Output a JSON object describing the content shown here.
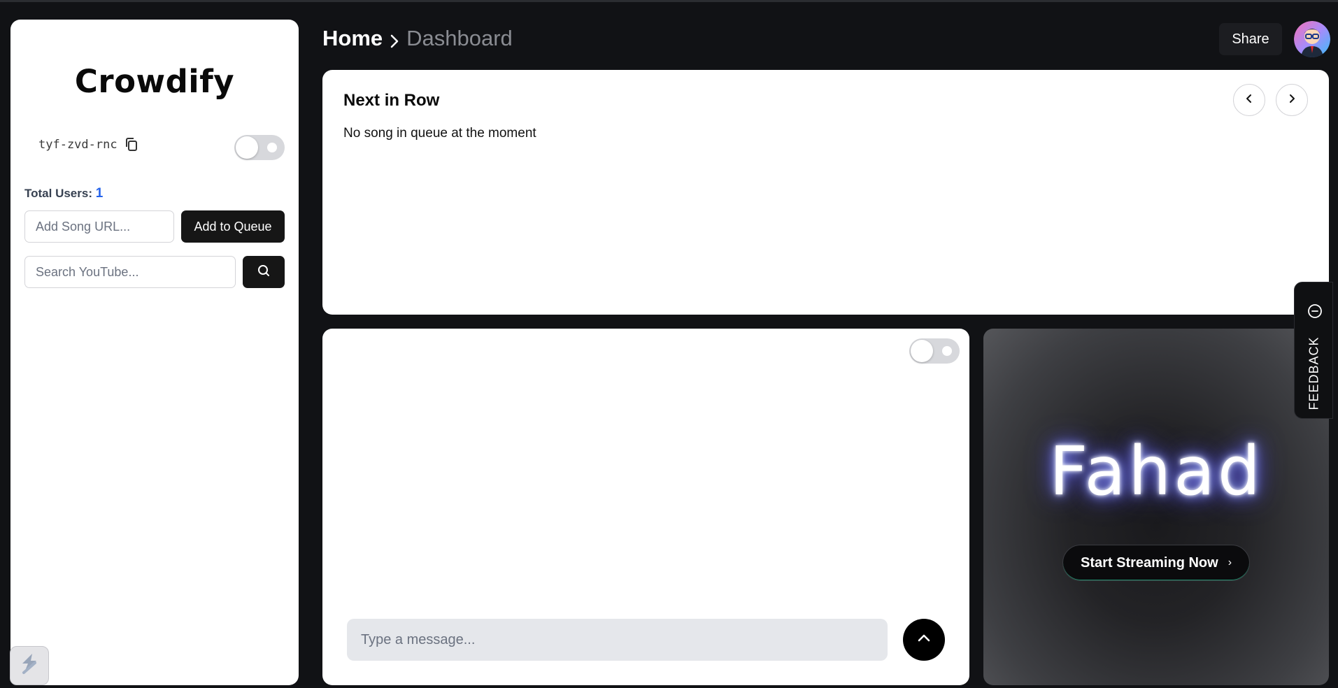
{
  "sidebar": {
    "brand": "Crowdify",
    "room_code": "tyf-zvd-rnc",
    "users_label": "Total Users:",
    "users_count": "1",
    "song_url_placeholder": "Add Song URL...",
    "add_button_label": "Add to Queue",
    "search_placeholder": "Search YouTube..."
  },
  "header": {
    "breadcrumb_home": "Home",
    "breadcrumb_current": "Dashboard",
    "share_label": "Share"
  },
  "queue": {
    "title": "Next in Row",
    "empty_text": "No song in queue at the moment"
  },
  "chat": {
    "message_placeholder": "Type a message..."
  },
  "stream": {
    "name": "Fahad",
    "start_label": "Start Streaming Now",
    "start_chevron": "›"
  },
  "feedback": {
    "label": "FEEDBACK"
  },
  "colors": {
    "page_background": "#111215",
    "card_background": "#ffffff",
    "accent_blue": "#2563eb",
    "button_dark": "#161616",
    "glow": "#6366f1"
  },
  "icons": [
    "copy-icon",
    "search-icon",
    "chevron-right-icon",
    "chevron-left-icon",
    "chevron-up-icon",
    "feedback-icon",
    "logo-icon",
    "avatar"
  ]
}
